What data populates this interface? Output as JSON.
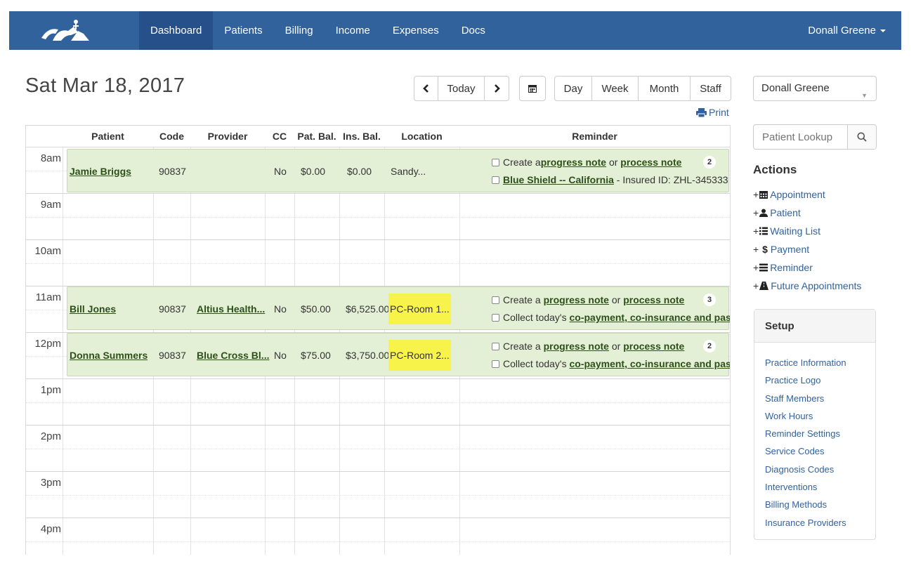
{
  "nav": {
    "items": [
      "Dashboard",
      "Patients",
      "Billing",
      "Income",
      "Expenses",
      "Docs"
    ],
    "active": "Dashboard",
    "user": "Donall Greene",
    "color": "#31629c"
  },
  "header": {
    "date": "Sat Mar 18, 2017",
    "today_label": "Today",
    "views": [
      "Day",
      "Week",
      "Month",
      "Staff"
    ],
    "print_label": "Print"
  },
  "table": {
    "columns": [
      "Patient",
      "Code",
      "Provider",
      "CC",
      "Pat. Bal.",
      "Ins. Bal.",
      "Location",
      "Reminder"
    ],
    "hours": [
      "8am",
      "9am",
      "10am",
      "11am",
      "12pm",
      "1pm",
      "2pm",
      "3pm",
      "4pm"
    ]
  },
  "appointments": [
    {
      "patient": "Jamie Briggs",
      "code": "90837",
      "provider": "",
      "cc": "No",
      "pat_bal": "$0.00",
      "ins_bal": "$0.00",
      "location": "Sandy...",
      "reminder_count": "2",
      "reminder1": {
        "pre": "Create a ",
        "link1": "progress note",
        "mid": " or ",
        "link2": "process note"
      },
      "reminder2": {
        "link": "Blue Shield -- California",
        "post": " - Insured ID: ZHL-345333"
      }
    },
    {
      "patient": "Bill Jones",
      "code": "90837",
      "provider": "Altius Health...",
      "cc": "No",
      "pat_bal": "$50.00",
      "ins_bal": "$6,525.00",
      "location": "PC-Room 1...",
      "reminder_count": "3",
      "reminder1": {
        "pre": "Create a ",
        "link1": "progress note",
        "mid": " or ",
        "link2": "process note"
      },
      "reminder2": {
        "pre": "Collect today's ",
        "link": "co-payment, co-insurance and past"
      }
    },
    {
      "patient": "Donna Summers",
      "code": "90837",
      "provider": "Blue Cross Bl...",
      "cc": "No",
      "pat_bal": "$75.00",
      "ins_bal": "$3,750.00",
      "location": "PC-Room 2...",
      "reminder_count": "2",
      "reminder1": {
        "pre": "Create a ",
        "link1": "progress note",
        "mid": " or ",
        "link2": "process note"
      },
      "reminder2": {
        "pre": "Collect today's ",
        "link": "co-payment, co-insurance and past"
      }
    }
  ],
  "sidebar": {
    "staff_select": "Donall Greene",
    "lookup_placeholder": "Patient Lookup",
    "actions_title": "Actions",
    "actions": [
      "Appointment",
      "Patient",
      "Waiting List",
      "Payment",
      "Reminder",
      "Future Appointments"
    ],
    "setup_title": "Setup",
    "setup_items": [
      "Practice Information",
      "Practice Logo",
      "Staff Members",
      "Work Hours",
      "Reminder Settings",
      "Service Codes",
      "Diagnosis Codes",
      "Interventions",
      "Billing Methods",
      "Insurance Providers"
    ]
  },
  "colors": {
    "appointment_bg": "#e3f0d6",
    "highlight": "#f7f34b",
    "link": "#31629c"
  }
}
